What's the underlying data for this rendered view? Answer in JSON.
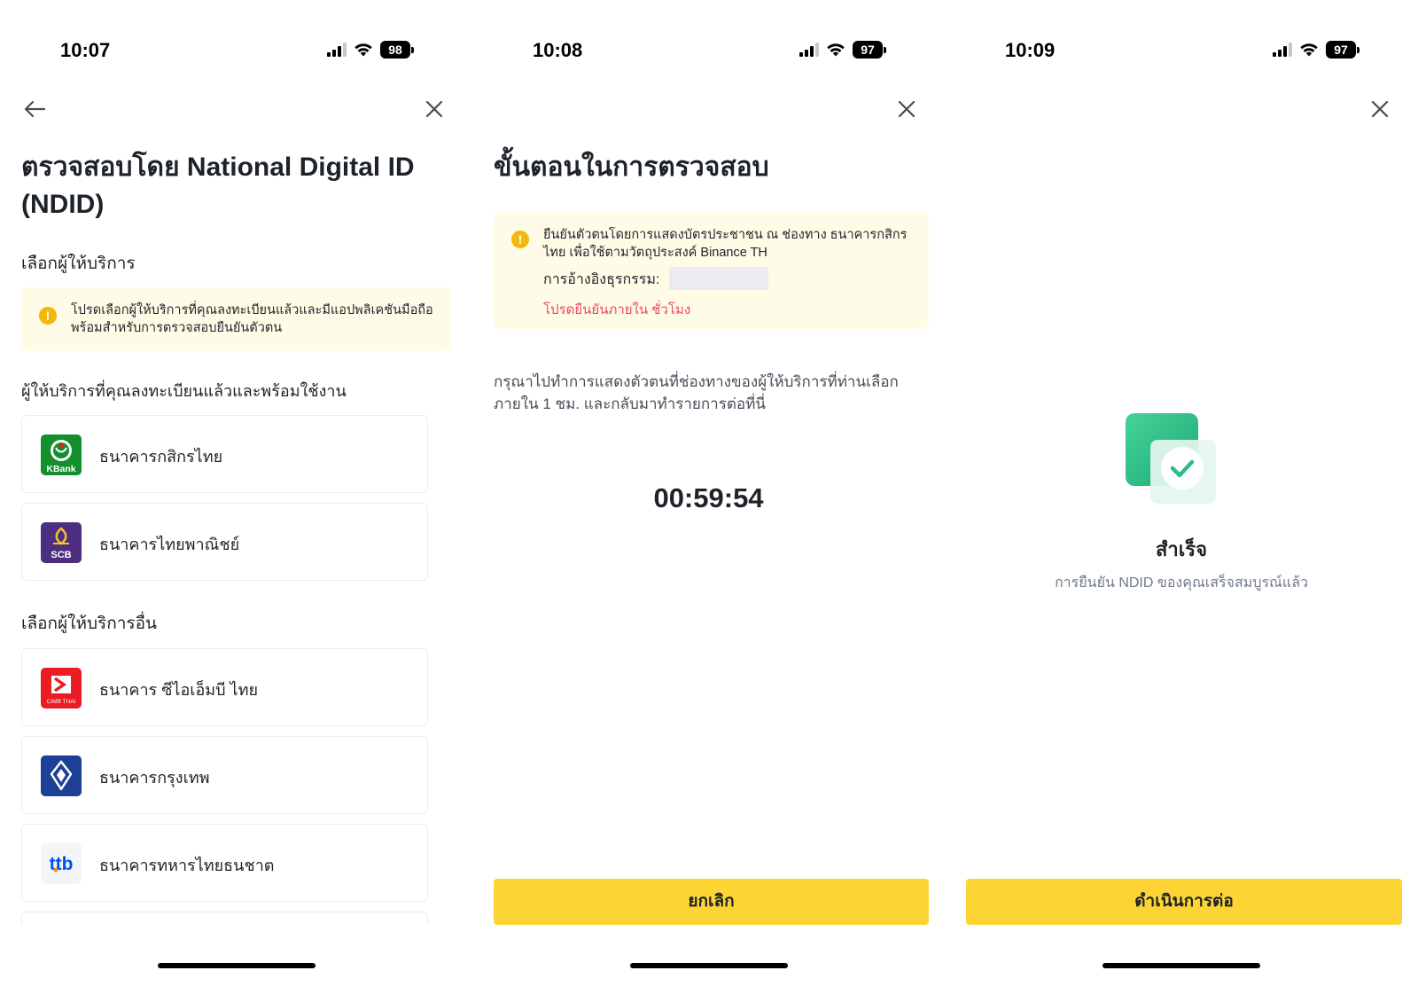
{
  "screens": [
    {
      "status": {
        "time": "10:07",
        "battery": "98"
      },
      "title": "ตรวจสอบโดย National Digital ID (NDID)",
      "select_provider_label": "เลือกผู้ให้บริการ",
      "notice_text": "โปรดเลือกผู้ให้บริการที่คุณลงทะเบียนแล้วและมีแอปพลิเคชันมือถือพร้อมสำหรับการตรวจสอบยืนยันตัวตน",
      "registered_label": "ผู้ให้บริการที่คุณลงทะเบียนแล้วและพร้อมใช้งาน",
      "registered_banks": [
        {
          "name": "ธนาคารกสิกรไทย",
          "icon": "kbank-logo",
          "logo_text": "KBank",
          "color": "#138f2d"
        },
        {
          "name": "ธนาคารไทยพาณิชย์",
          "icon": "scb-logo",
          "logo_text": "SCB",
          "color": "#4e2e7f"
        }
      ],
      "other_label": "เลือกผู้ให้บริการอื่น",
      "other_banks": [
        {
          "name": "ธนาคาร ซีไอเอ็มบี ไทย",
          "icon": "cimb-logo",
          "logo_text": "CIMB THAI",
          "color": "#ec1c24"
        },
        {
          "name": "ธนาคารกรุงเทพ",
          "icon": "bbl-logo",
          "color": "#1e3f96"
        },
        {
          "name": "ธนาคารทหารไทยธนชาต",
          "icon": "ttb-logo",
          "logo_text": "ttb",
          "color": "#0050f0"
        }
      ]
    },
    {
      "status": {
        "time": "10:08",
        "battery": "97"
      },
      "title": "ขั้นตอนในการตรวจสอบ",
      "notice_text": "ยืนยันตัวตนโดยการแสดงบัตรประชาชน ณ ช่องทาง ธนาคารกสิกรไทย เพื่อใช้ตามวัตถุประสงค์ Binance TH",
      "reference_label": "การอ้างอิงธุรกรรม:",
      "deadline_text": "โปรดยืนยันภายใน ชั่วโมง",
      "instruction": "กรุณาไปทำการแสดงตัวตนที่ช่องทางของผู้ให้บริการที่ท่านเลือกภายใน 1 ชม. และกลับมาทำรายการต่อที่นี่",
      "timer": "00:59:54",
      "button": "ยกเลิก"
    },
    {
      "status": {
        "time": "10:09",
        "battery": "97"
      },
      "success_title": "สำเร็จ",
      "success_subtitle": "การยืนยัน NDID ของคุณเสร็จสมบูรณ์แล้ว",
      "button": "ดำเนินการต่อ"
    }
  ],
  "colors": {
    "accent": "#fcd535",
    "warning_bg": "#fefbe6",
    "warning_icon": "#f0b90b",
    "error": "#f6465d",
    "success": "#2ebd85"
  }
}
